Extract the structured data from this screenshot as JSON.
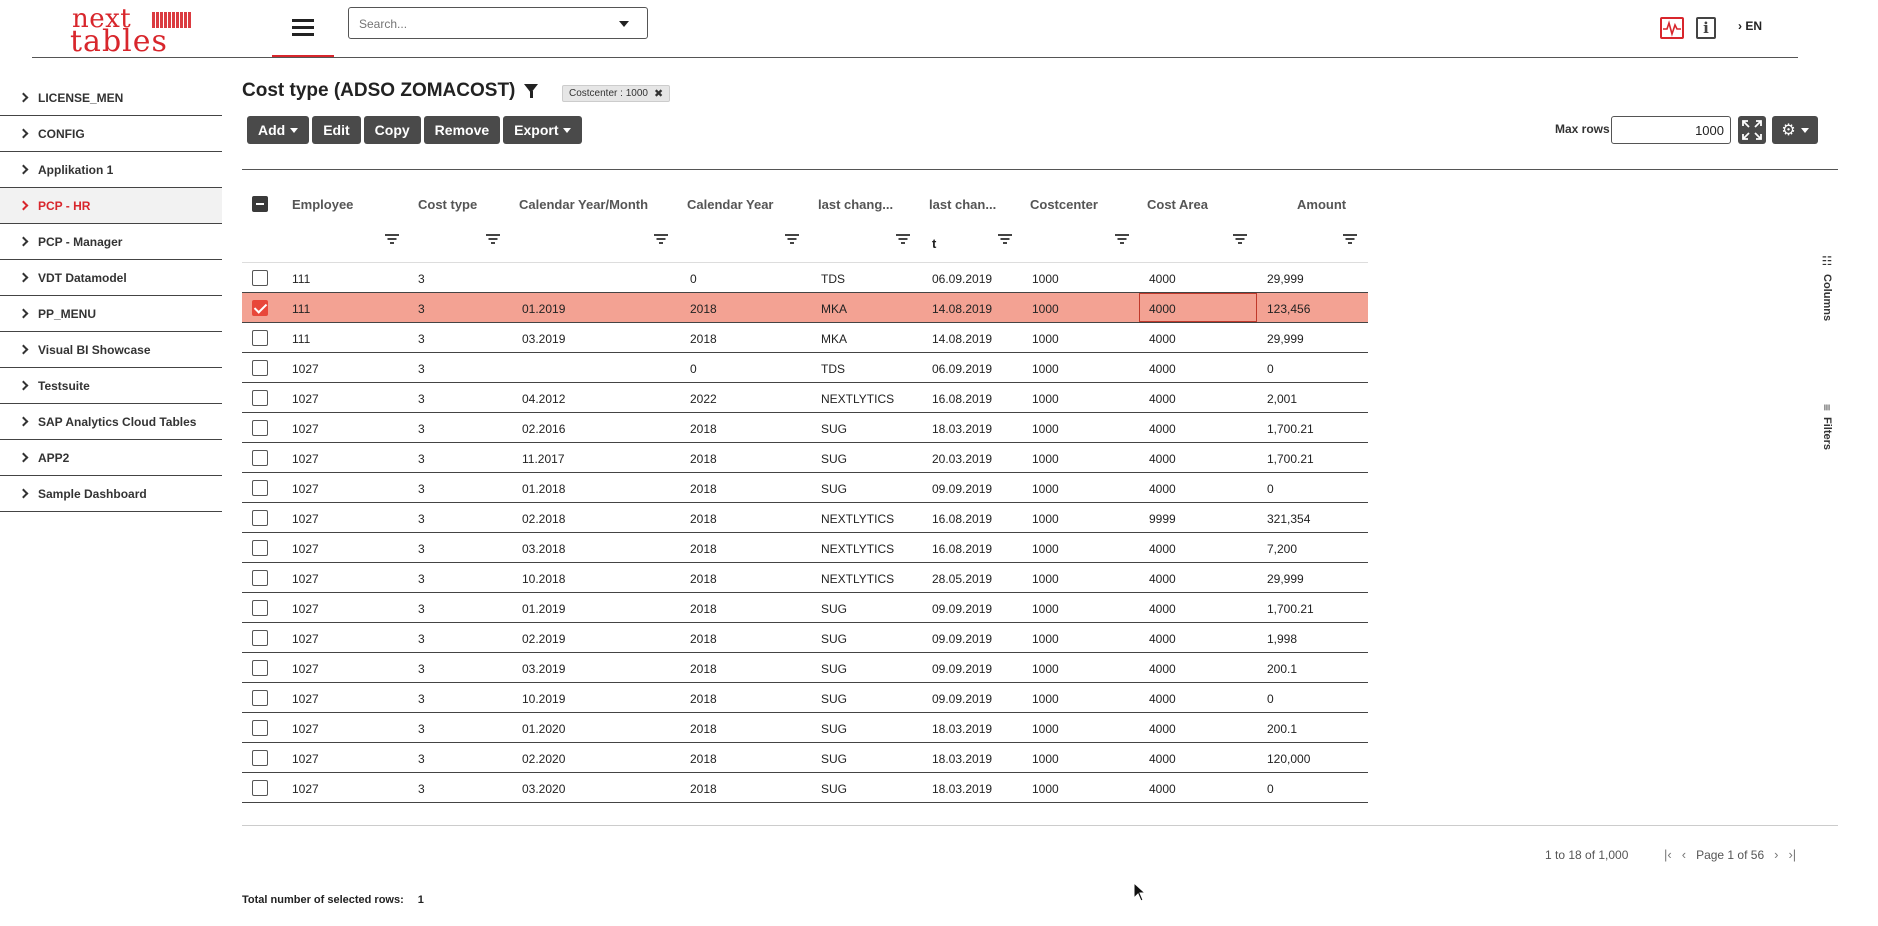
{
  "header": {
    "logo_top": "next",
    "logo_bottom": "tables",
    "search_placeholder": "Search...",
    "language": "EN",
    "info_icon": "i"
  },
  "sidebar": {
    "items": [
      {
        "label": "LICENSE_MEN",
        "active": false
      },
      {
        "label": "CONFIG",
        "active": false
      },
      {
        "label": "Applikation 1",
        "active": false
      },
      {
        "label": "PCP - HR",
        "active": true
      },
      {
        "label": "PCP - Manager",
        "active": false
      },
      {
        "label": "VDT Datamodel",
        "active": false
      },
      {
        "label": "PP_MENU",
        "active": false
      },
      {
        "label": "Visual BI Showcase",
        "active": false
      },
      {
        "label": "Testsuite",
        "active": false
      },
      {
        "label": "SAP Analytics Cloud Tables",
        "active": false
      },
      {
        "label": "APP2",
        "active": false
      },
      {
        "label": "Sample Dashboard",
        "active": false
      }
    ]
  },
  "main": {
    "title": "Cost type (ADSO ZOMACOST)",
    "filter_chip": "Costcenter : 1000",
    "filter_chip_close": "✖",
    "toolbar": {
      "add": "Add",
      "edit": "Edit",
      "copy": "Copy",
      "remove": "Remove",
      "export": "Export"
    },
    "max_rows_label": "Max rows",
    "max_rows_value": "1000",
    "gear_icon": "⚙"
  },
  "table": {
    "columns": [
      "Employee",
      "Cost type",
      "Calendar Year/Month",
      "Calendar Year",
      "last chang...",
      "last chan...",
      "Costcenter",
      "Cost Area",
      "Amount"
    ],
    "filter_text": "t",
    "rows": [
      {
        "selected": false,
        "cells": [
          "111",
          "3",
          "",
          "0",
          "TDS",
          "06.09.2019",
          "1000",
          "4000",
          "29,999"
        ]
      },
      {
        "selected": true,
        "cells": [
          "111",
          "3",
          "01.2019",
          "2018",
          "MKA",
          "14.08.2019",
          "1000",
          "4000",
          "123,456"
        ]
      },
      {
        "selected": false,
        "cells": [
          "111",
          "3",
          "03.2019",
          "2018",
          "MKA",
          "14.08.2019",
          "1000",
          "4000",
          "29,999"
        ]
      },
      {
        "selected": false,
        "cells": [
          "1027",
          "3",
          "",
          "0",
          "TDS",
          "06.09.2019",
          "1000",
          "4000",
          "0"
        ]
      },
      {
        "selected": false,
        "cells": [
          "1027",
          "3",
          "04.2012",
          "2022",
          "NEXTLYTICS",
          "16.08.2019",
          "1000",
          "4000",
          "2,001"
        ]
      },
      {
        "selected": false,
        "cells": [
          "1027",
          "3",
          "02.2016",
          "2018",
          "SUG",
          "18.03.2019",
          "1000",
          "4000",
          "1,700.21"
        ]
      },
      {
        "selected": false,
        "cells": [
          "1027",
          "3",
          "11.2017",
          "2018",
          "SUG",
          "20.03.2019",
          "1000",
          "4000",
          "1,700.21"
        ]
      },
      {
        "selected": false,
        "cells": [
          "1027",
          "3",
          "01.2018",
          "2018",
          "SUG",
          "09.09.2019",
          "1000",
          "4000",
          "0"
        ]
      },
      {
        "selected": false,
        "cells": [
          "1027",
          "3",
          "02.2018",
          "2018",
          "NEXTLYTICS",
          "16.08.2019",
          "1000",
          "9999",
          "321,354"
        ]
      },
      {
        "selected": false,
        "cells": [
          "1027",
          "3",
          "03.2018",
          "2018",
          "NEXTLYTICS",
          "16.08.2019",
          "1000",
          "4000",
          "7,200"
        ]
      },
      {
        "selected": false,
        "cells": [
          "1027",
          "3",
          "10.2018",
          "2018",
          "NEXTLYTICS",
          "28.05.2019",
          "1000",
          "4000",
          "29,999"
        ]
      },
      {
        "selected": false,
        "cells": [
          "1027",
          "3",
          "01.2019",
          "2018",
          "SUG",
          "09.09.2019",
          "1000",
          "4000",
          "1,700.21"
        ]
      },
      {
        "selected": false,
        "cells": [
          "1027",
          "3",
          "02.2019",
          "2018",
          "SUG",
          "09.09.2019",
          "1000",
          "4000",
          "1,998"
        ]
      },
      {
        "selected": false,
        "cells": [
          "1027",
          "3",
          "03.2019",
          "2018",
          "SUG",
          "09.09.2019",
          "1000",
          "4000",
          "200.1"
        ]
      },
      {
        "selected": false,
        "cells": [
          "1027",
          "3",
          "10.2019",
          "2018",
          "SUG",
          "09.09.2019",
          "1000",
          "4000",
          "0"
        ]
      },
      {
        "selected": false,
        "cells": [
          "1027",
          "3",
          "01.2020",
          "2018",
          "SUG",
          "18.03.2019",
          "1000",
          "4000",
          "200.1"
        ]
      },
      {
        "selected": false,
        "cells": [
          "1027",
          "3",
          "02.2020",
          "2018",
          "SUG",
          "18.03.2019",
          "1000",
          "4000",
          "120,000"
        ]
      },
      {
        "selected": false,
        "cells": [
          "1027",
          "3",
          "03.2020",
          "2018",
          "SUG",
          "18.03.2019",
          "1000",
          "4000",
          "0"
        ]
      }
    ]
  },
  "side_panels": {
    "columns": "Columns",
    "filters": "Filters"
  },
  "footer": {
    "range": "1 to 18 of 1,000",
    "page": "Page 1 of 56",
    "selected_label": "Total number of selected rows:",
    "selected_count": "1"
  },
  "colors": {
    "accent": "#d8262c",
    "selected_row": "#f3a293",
    "button_bg": "#4a4a4a"
  }
}
